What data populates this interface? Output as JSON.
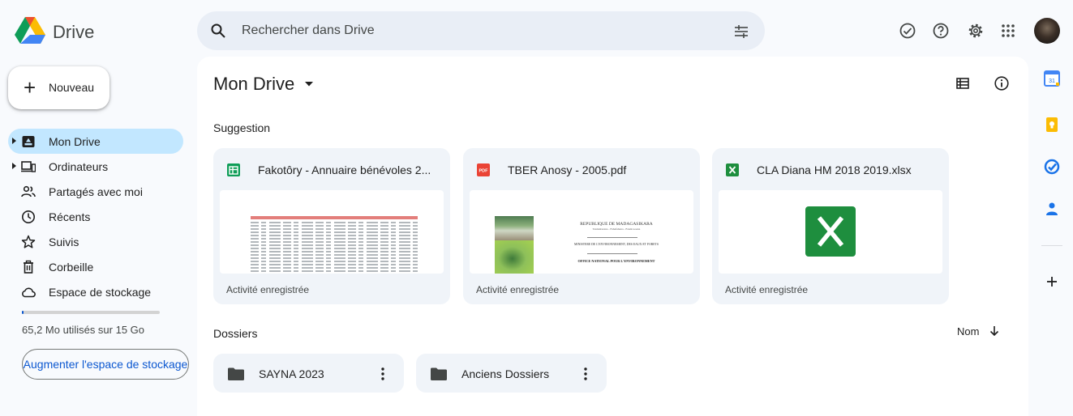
{
  "header": {
    "app_name": "Drive",
    "search_placeholder": "Rechercher dans Drive"
  },
  "sidebar": {
    "new_button": "Nouveau",
    "items": [
      {
        "label": "Mon Drive",
        "icon": "my-drive-icon",
        "active": true
      },
      {
        "label": "Ordinateurs",
        "icon": "computers-icon"
      },
      {
        "label": "Partagés avec moi",
        "icon": "shared-people-icon"
      },
      {
        "label": "Récents",
        "icon": "clock-icon"
      },
      {
        "label": "Suivis",
        "icon": "star-icon"
      },
      {
        "label": "Corbeille",
        "icon": "trash-icon"
      },
      {
        "label": "Espace de stockage",
        "icon": "cloud-icon"
      }
    ],
    "storage_text": "65,2 Mo utilisés sur 15 Go",
    "storage_fraction": 0.004,
    "upgrade_button": "Augmenter l'espace de stockage"
  },
  "main": {
    "title": "Mon Drive",
    "suggestion_label": "Suggestion",
    "cards": [
      {
        "name": "Fakotôry - Annuaire bénévoles 2...",
        "type": "sheets",
        "activity": "Activité enregistrée"
      },
      {
        "name": "TBER Anosy - 2005.pdf",
        "type": "pdf",
        "activity": "Activité enregistrée",
        "preview_lines": [
          "REPUBLIQUE DE MADAGASIKARA",
          "Tanindrazana - Fahafahana - Fandrosoana",
          "MINISTERE DE L'ENVIRONNEMENT, DES EAUX ET FORETS",
          "OFFICE NATIONAL POUR L'ENVIRONNEMENT"
        ]
      },
      {
        "name": "CLA Diana HM 2018 2019.xlsx",
        "type": "excel",
        "activity": "Activité enregistrée"
      }
    ],
    "folders_label": "Dossiers",
    "sort_label": "Nom",
    "folders": [
      {
        "name": "SAYNA 2023"
      },
      {
        "name": "Anciens Dossiers"
      }
    ]
  },
  "colors": {
    "accent": "#0b57d0",
    "active_nav": "#c2e7ff",
    "sheets_green": "#0f9d58",
    "excel_green": "#1e7e45",
    "pdf_red": "#ea4335"
  }
}
